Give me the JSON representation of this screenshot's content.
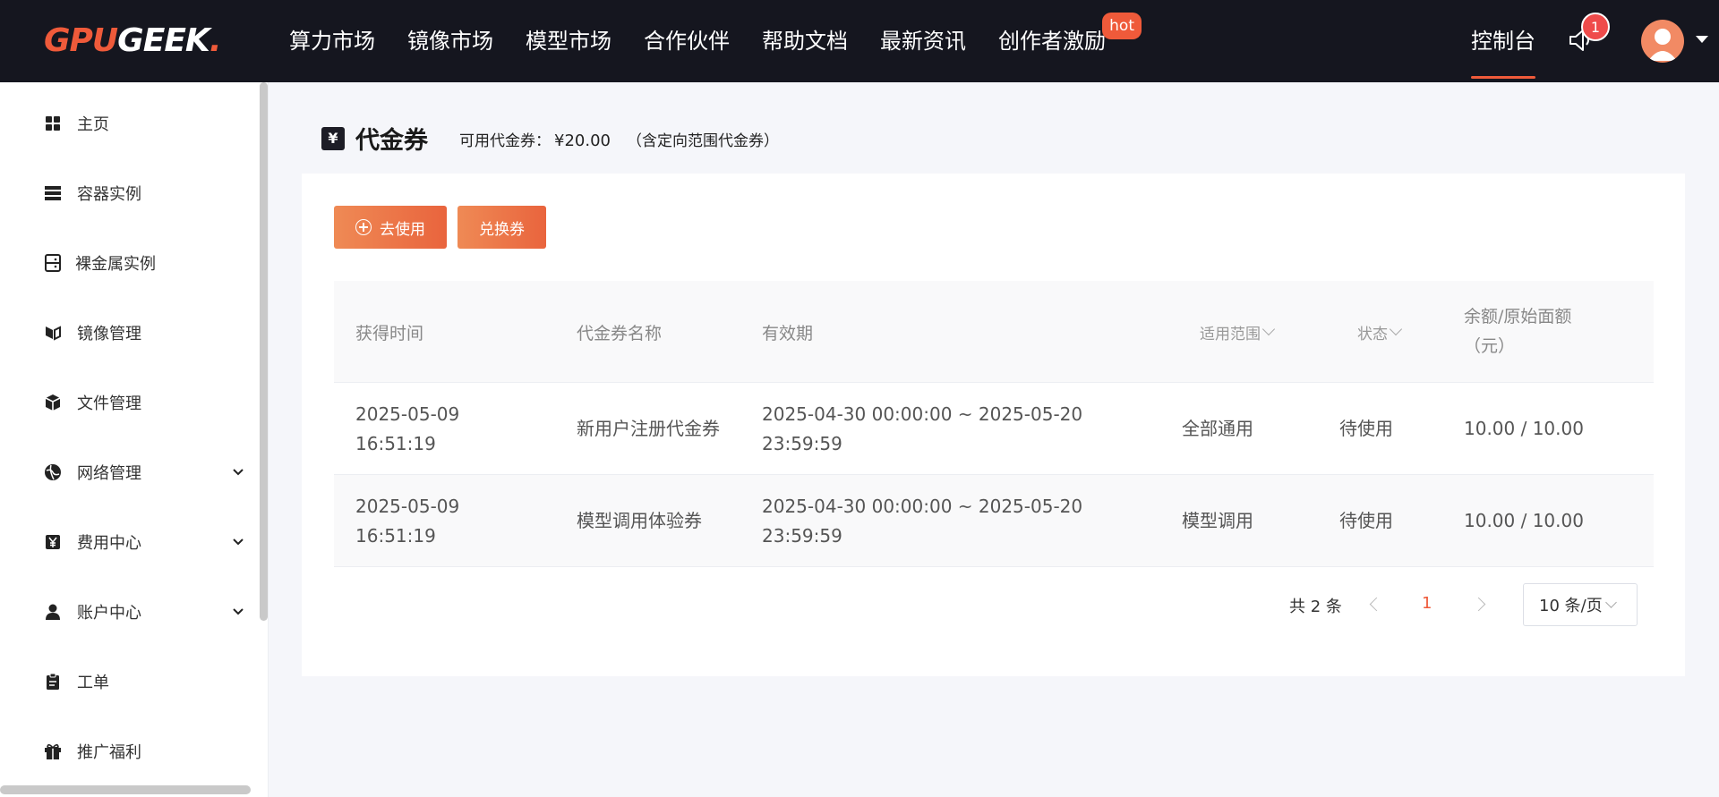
{
  "brand": {
    "part1": "GPU",
    "part2": "GEEK",
    "dot": "."
  },
  "nav": {
    "items": [
      "算力市场",
      "镜像市场",
      "模型市场",
      "合作伙伴",
      "帮助文档",
      "最新资讯",
      "创作者激励"
    ],
    "hot_label": "hot",
    "console": "控制台",
    "notification_count": "1"
  },
  "sidebar": {
    "items": [
      {
        "label": "主页",
        "icon": "grid-icon",
        "expandable": false
      },
      {
        "label": "容器实例",
        "icon": "server-stack-icon",
        "expandable": false
      },
      {
        "label": "裸金属实例",
        "icon": "bare-metal-icon",
        "expandable": false
      },
      {
        "label": "镜像管理",
        "icon": "image-icon",
        "expandable": false
      },
      {
        "label": "文件管理",
        "icon": "box-icon",
        "expandable": false
      },
      {
        "label": "网络管理",
        "icon": "network-icon",
        "expandable": true
      },
      {
        "label": "费用中心",
        "icon": "yen-icon",
        "expandable": true
      },
      {
        "label": "账户中心",
        "icon": "user-icon",
        "expandable": true
      },
      {
        "label": "工单",
        "icon": "clipboard-icon",
        "expandable": false
      },
      {
        "label": "推广福利",
        "icon": "gift-icon",
        "expandable": false
      }
    ]
  },
  "page": {
    "title_icon": "¥",
    "title": "代金券",
    "available_label": "可用代金券：",
    "available_amount": "¥20.00",
    "available_note": "（含定向范围代金券）"
  },
  "toolbar": {
    "use_label": "去使用",
    "exchange_label": "兑换券"
  },
  "table": {
    "headers": {
      "time": "获得时间",
      "name": "代金券名称",
      "validity": "有效期",
      "scope": "适用范围",
      "status": "状态",
      "amount_line1": "余额/原始面额",
      "amount_line2": "（元）"
    },
    "rows": [
      {
        "date": "2025-05-09",
        "time": "16:51:19",
        "name": "新用户注册代金券",
        "validity": "2025-04-30 00:00:00 ~ 2025-05-20 23:59:59",
        "scope": "全部通用",
        "status": "待使用",
        "amount": "10.00 / 10.00"
      },
      {
        "date": "2025-05-09",
        "time": "16:51:19",
        "name": "模型调用体验券",
        "validity": "2025-04-30 00:00:00 ~ 2025-05-20 23:59:59",
        "scope": "模型调用",
        "status": "待使用",
        "amount": "10.00 / 10.00"
      }
    ]
  },
  "pagination": {
    "total": "共 2 条",
    "current": "1",
    "page_size": "10 条/页"
  },
  "colors": {
    "accent": "#ef5a3a",
    "topbar": "#15161f",
    "button": "#e9643d"
  }
}
